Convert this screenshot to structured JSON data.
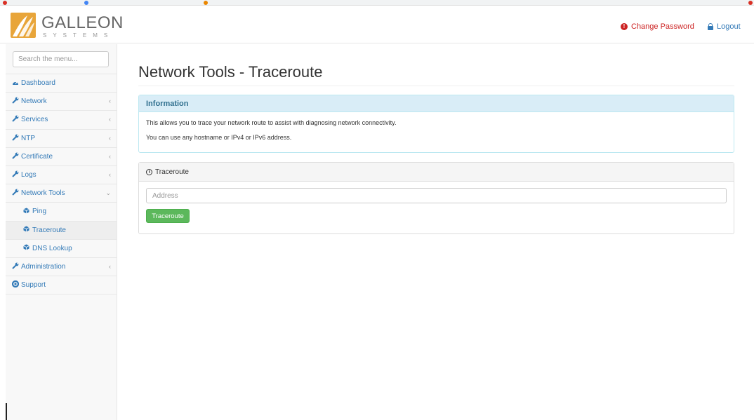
{
  "brand": {
    "name": "GALLEON",
    "subtitle": "SYSTEMS"
  },
  "header": {
    "change_password": "Change Password",
    "logout": "Logout"
  },
  "sidebar": {
    "search_placeholder": "Search the menu...",
    "items": [
      {
        "label": "Dashboard",
        "icon": "dashboard-icon",
        "arrow": ""
      },
      {
        "label": "Network",
        "icon": "wrench-icon",
        "arrow": "‹"
      },
      {
        "label": "Services",
        "icon": "wrench-icon",
        "arrow": "‹"
      },
      {
        "label": "NTP",
        "icon": "wrench-icon",
        "arrow": "‹"
      },
      {
        "label": "Certificate",
        "icon": "wrench-icon",
        "arrow": "‹"
      },
      {
        "label": "Logs",
        "icon": "wrench-icon",
        "arrow": "‹"
      },
      {
        "label": "Network Tools",
        "icon": "wrench-icon",
        "arrow": "⌄"
      },
      {
        "label": "Ping",
        "icon": "cube-icon",
        "arrow": ""
      },
      {
        "label": "Traceroute",
        "icon": "cube-icon",
        "arrow": ""
      },
      {
        "label": "DNS Lookup",
        "icon": "cube-icon",
        "arrow": ""
      },
      {
        "label": "Administration",
        "icon": "wrench-icon",
        "arrow": "‹"
      },
      {
        "label": "Support",
        "icon": "lifebuoy-icon",
        "arrow": ""
      }
    ]
  },
  "main": {
    "title": "Network Tools - Traceroute",
    "info_panel": {
      "heading": "Information",
      "line1": "This allows you to trace your network route to assist with diagnosing network connectivity.",
      "line2": "You can use any hostname or IPv4 or IPv6 address."
    },
    "traceroute_panel": {
      "heading": "Traceroute",
      "address_placeholder": "Address",
      "button_label": "Traceroute"
    }
  },
  "colors": {
    "brand_orange": "#e8a53a",
    "link_blue": "#337ab7",
    "danger_red": "#cc2222",
    "success_green": "#5cb85c",
    "info_bg": "#d9edf7"
  }
}
